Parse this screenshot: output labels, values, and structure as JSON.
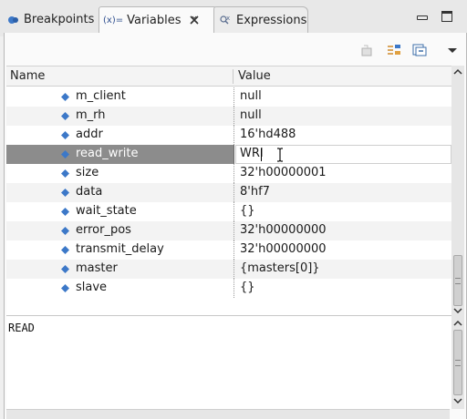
{
  "tabs": [
    {
      "label": "Breakpoints",
      "icon": "breakpoints-icon"
    },
    {
      "label": "Variables",
      "icon": "variables-icon",
      "icon_text": "(x)=",
      "active": true
    },
    {
      "label": "Expressions",
      "icon": "expressions-icon"
    }
  ],
  "columns": {
    "name": "Name",
    "value": "Value"
  },
  "variables": [
    {
      "name": "m_client",
      "value": "null"
    },
    {
      "name": "m_rh",
      "value": "null"
    },
    {
      "name": "addr",
      "value": "16'hd488"
    },
    {
      "name": "read_write",
      "value": "WRI",
      "selected": true,
      "editing": true
    },
    {
      "name": "size",
      "value": "32'h00000001"
    },
    {
      "name": "data",
      "value": "8'hf7"
    },
    {
      "name": "wait_state",
      "value": "{}"
    },
    {
      "name": "error_pos",
      "value": "32'h00000000"
    },
    {
      "name": "transmit_delay",
      "value": "32'h00000000"
    },
    {
      "name": "master",
      "value": "{masters[0]}"
    },
    {
      "name": "slave",
      "value": "{}"
    }
  ],
  "detail": {
    "text": "READ"
  },
  "colors": {
    "variable_icon": "#3c78c8",
    "selection": "#8c8c8c",
    "expressions_icon": "#5a6d8f"
  }
}
